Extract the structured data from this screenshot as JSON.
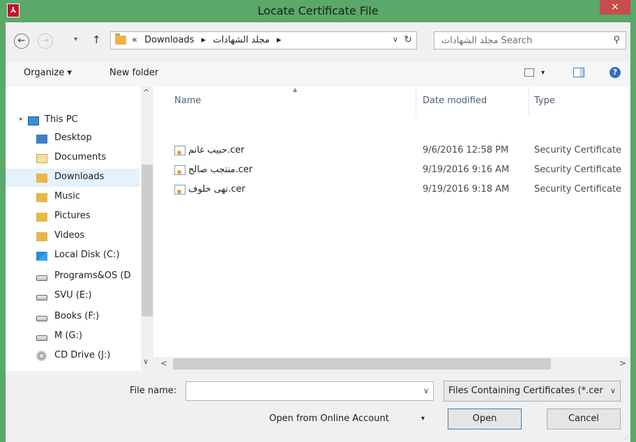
{
  "window": {
    "title": "Locate Certificate File",
    "close_label": "×",
    "accent_color": "#5aa86a"
  },
  "addressbar": {
    "back_icon": "←",
    "forward_icon": "→",
    "recent_dd": "▾",
    "up_icon": "↑",
    "overflow": "«",
    "crumbs": [
      "Downloads",
      "▸",
      "مجلد الشهادات",
      "▸"
    ],
    "dropdown": "∨",
    "refresh": "↻",
    "search_placeholder": "مجلد الشهادات Search",
    "search_icon": "⚲"
  },
  "toolbar": {
    "organize": "Organize ▾",
    "new_folder": "New folder",
    "view_dd": "▾",
    "help": "?"
  },
  "nav": {
    "scroll_up": "^",
    "scroll_down": "∨",
    "items": [
      {
        "label": "This PC"
      },
      {
        "label": "Desktop"
      },
      {
        "label": "Documents"
      },
      {
        "label": "Downloads"
      },
      {
        "label": "Music"
      },
      {
        "label": "Pictures"
      },
      {
        "label": "Videos"
      },
      {
        "label": "Local Disk (C:)"
      },
      {
        "label": "Programs&OS (D"
      },
      {
        "label": "SVU (E:)"
      },
      {
        "label": "Books (F:)"
      },
      {
        "label": "M (G:)"
      },
      {
        "label": "CD Drive (J:)"
      }
    ],
    "expander": "▸",
    "selected": "Downloads"
  },
  "columns": {
    "name": "Name",
    "date": "Date modified",
    "type": "Type",
    "sort_arrow": "▲"
  },
  "files": [
    {
      "name": "حبيب غانم.cer",
      "date": "9/6/2016 12:58 PM",
      "type": "Security Certificate"
    },
    {
      "name": "منتجب صالح.cer",
      "date": "9/19/2016 9:16 AM",
      "type": "Security Certificate"
    },
    {
      "name": "نهى خلوف.cer",
      "date": "9/19/2016 9:18 AM",
      "type": "Security Certificate"
    }
  ],
  "hscroll": {
    "left": "<",
    "right": ">"
  },
  "footer": {
    "file_name_label": "File name:",
    "file_name_value": "",
    "file_name_dd": "∨",
    "filter": "Files Containing Certificates (*.cer;*.crt)",
    "filter_dd": "∨",
    "online": "Open from Online Account",
    "online_dd": "▾",
    "open": "Open",
    "cancel": "Cancel",
    "grip": "⋰"
  }
}
